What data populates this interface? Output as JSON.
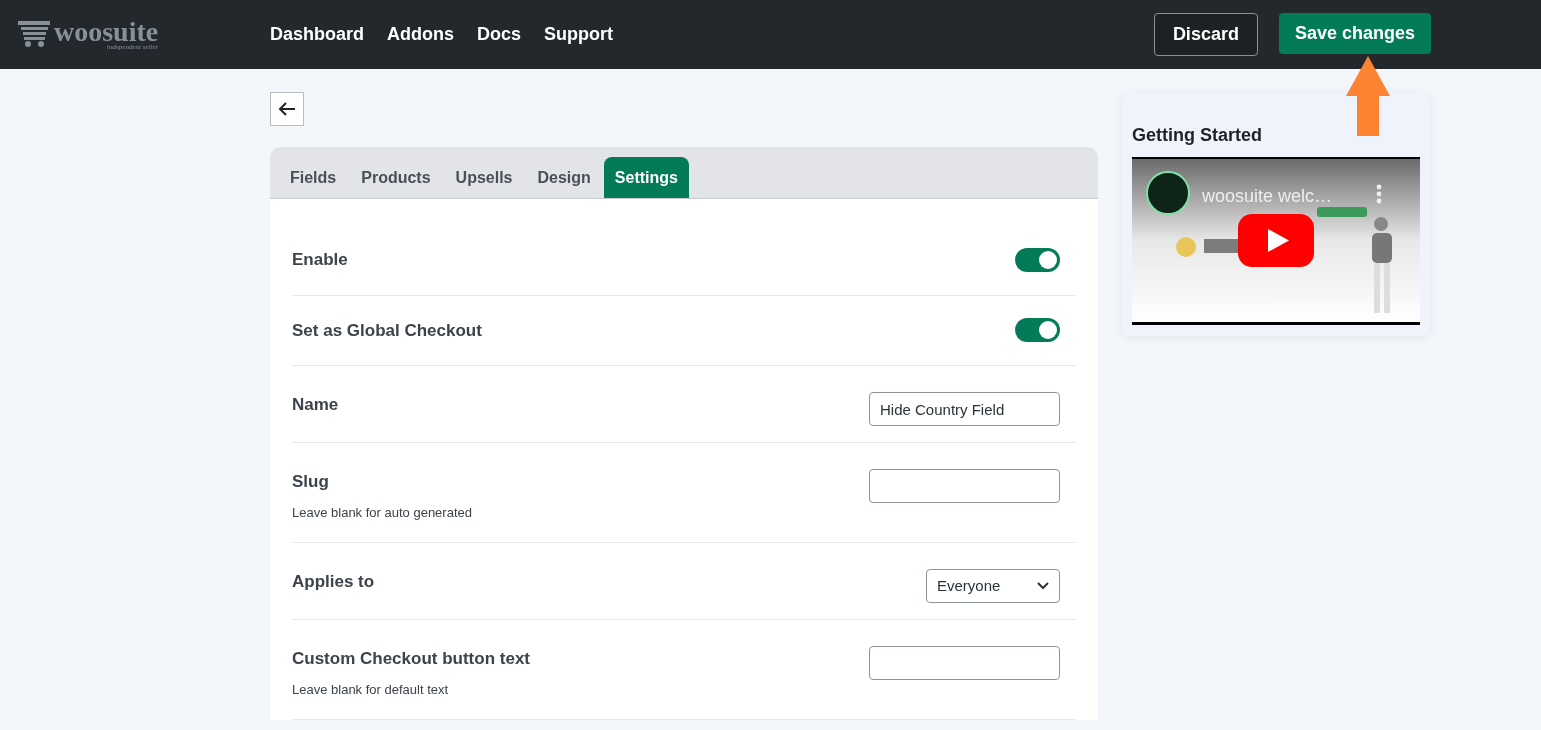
{
  "header": {
    "logo": {
      "name": "woosuite",
      "tagline": "independent seller"
    },
    "nav": [
      "Dashboard",
      "Addons",
      "Docs",
      "Support"
    ],
    "buttons": [
      {
        "label": "Discard",
        "kind": "secondary"
      },
      {
        "label": "Save changes",
        "kind": "primary"
      }
    ]
  },
  "tabs": [
    {
      "label": "Fields",
      "selected": false
    },
    {
      "label": "Products",
      "selected": false
    },
    {
      "label": "Upsells",
      "selected": false
    },
    {
      "label": "Design",
      "selected": false
    },
    {
      "label": "Settings",
      "selected": true
    }
  ],
  "settings": [
    {
      "kind": "toggle",
      "label": "Enable",
      "on": true
    },
    {
      "kind": "toggle",
      "label": "Set as Global Checkout",
      "on": true
    },
    {
      "kind": "text",
      "label": "Name",
      "value": "Hide Country Field"
    },
    {
      "kind": "text",
      "label": "Slug",
      "hint": "Leave blank for auto generated"
    },
    {
      "kind": "select",
      "label": "Applies to",
      "value": "Everyone"
    },
    {
      "kind": "text",
      "label": "Custom Checkout button text",
      "hint": "Leave blank for default text"
    }
  ],
  "sidebar": {
    "title": "Getting Started",
    "video": {
      "title": "woosuite welc…"
    }
  }
}
